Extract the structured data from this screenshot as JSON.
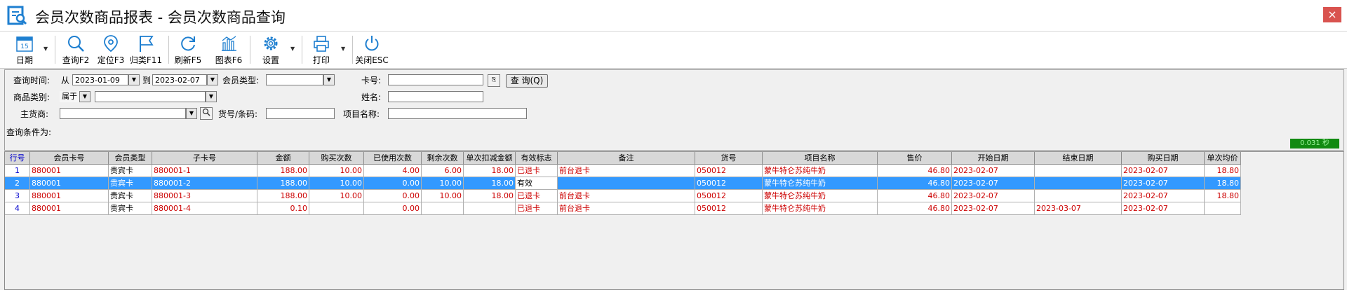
{
  "window": {
    "title": "会员次数商品报表 - 会员次数商品查询",
    "close_label": "×"
  },
  "toolbar": {
    "buttons": [
      {
        "label": "日期",
        "icon": "calendar-icon"
      },
      {
        "label": "查询F2",
        "icon": "search-icon"
      },
      {
        "label": "定位F3",
        "icon": "location-pin-icon"
      },
      {
        "label": "归类F11",
        "icon": "flag-icon"
      },
      {
        "label": "刷新F5",
        "icon": "refresh-icon"
      },
      {
        "label": "图表F6",
        "icon": "chart-icon"
      },
      {
        "label": "设置",
        "icon": "gear-icon"
      },
      {
        "label": "打印",
        "icon": "printer-icon"
      },
      {
        "label": "关闭ESC",
        "icon": "power-icon"
      }
    ],
    "calendar_day": "15"
  },
  "filter": {
    "query_time_label": "查询时间:",
    "from_label": "从",
    "from_value": "2023-01-09",
    "to_label": "到",
    "to_value": "2023-02-07",
    "member_type_label": "会员类型:",
    "member_type_value": "",
    "card_no_label": "卡号:",
    "card_no_value": "",
    "query_button": "查 询(Q)",
    "category_label": "商品类别:",
    "category_op": "属于",
    "category_value": "",
    "name_label": "姓名:",
    "name_value": "",
    "supplier_label": "主货商:",
    "supplier_value": "",
    "sku_label": "货号/条码:",
    "sku_value": "",
    "item_name_label": "项目名称:",
    "item_name_value": ""
  },
  "condition": {
    "label": "查询条件为:",
    "timer": "0.031 秒"
  },
  "table": {
    "columns": [
      "行号",
      "会员卡号",
      "会员类型",
      "子卡号",
      "金额",
      "购买次数",
      "已使用次数",
      "剩余次数",
      "单次扣减金额",
      "有效标志",
      "备注",
      "货号",
      "项目名称",
      "售价",
      "开始日期",
      "结束日期",
      "购买日期",
      "单次均价"
    ],
    "rows": [
      [
        "1",
        "880001",
        "贵宾卡",
        "880001-1",
        "188.00",
        "10.00",
        "4.00",
        "6.00",
        "18.00",
        "已退卡",
        "前台退卡",
        "050012",
        "蒙牛特仑苏纯牛奶",
        "46.80",
        "2023-02-07",
        "",
        "2023-02-07",
        "18.80"
      ],
      [
        "2",
        "880001",
        "贵宾卡",
        "880001-2",
        "188.00",
        "10.00",
        "0.00",
        "10.00",
        "18.00",
        "有效",
        "",
        "050012",
        "蒙牛特仑苏纯牛奶",
        "46.80",
        "2023-02-07",
        "",
        "2023-02-07",
        "18.80"
      ],
      [
        "3",
        "880001",
        "贵宾卡",
        "880001-3",
        "188.00",
        "10.00",
        "0.00",
        "10.00",
        "18.00",
        "已退卡",
        "前台退卡",
        "050012",
        "蒙牛特仑苏纯牛奶",
        "46.80",
        "2023-02-07",
        "",
        "2023-02-07",
        "18.80"
      ],
      [
        "4",
        "880001",
        "贵宾卡",
        "880001-4",
        "0.10",
        "",
        "0.00",
        "",
        "",
        "已退卡",
        "前台退卡",
        "050012",
        "蒙牛特仑苏纯牛奶",
        "46.80",
        "2023-02-07",
        "2023-03-07",
        "2023-02-07",
        ""
      ]
    ],
    "selected_row": 2
  }
}
